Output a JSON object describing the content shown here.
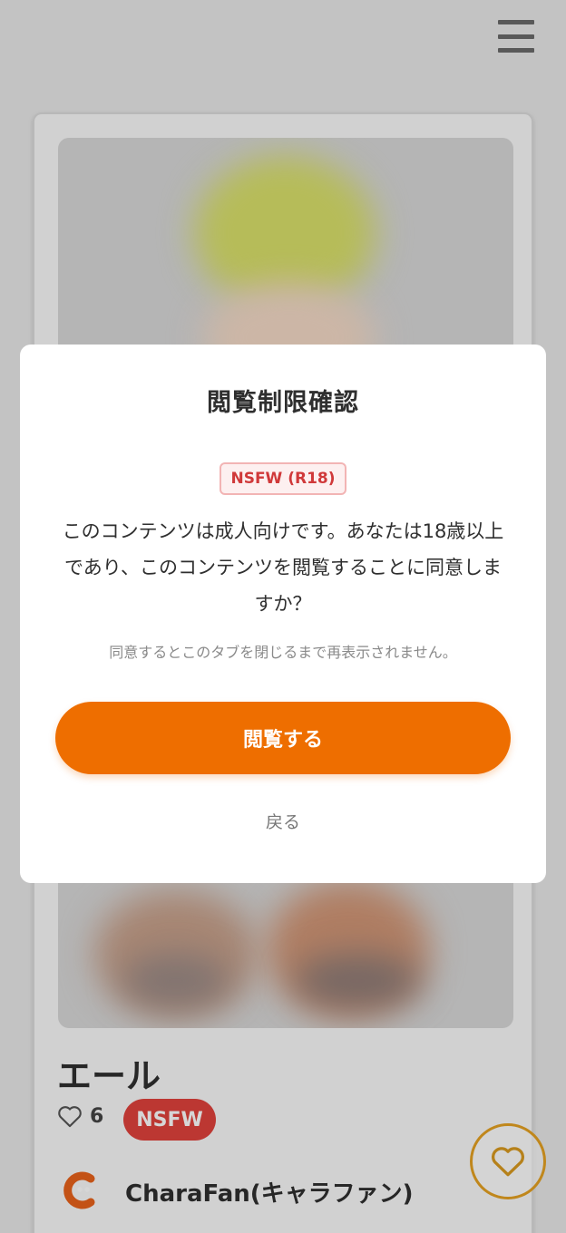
{
  "header": {
    "menu_icon": "hamburger-menu-icon"
  },
  "character": {
    "name": "エール",
    "like_count": "6",
    "rating_tag": "NSFW",
    "site_name": "CharaFan(キャラファン)",
    "favorite_icon": "heart-icon"
  },
  "modal": {
    "title": "閲覧制限確認",
    "rating_badge": "NSFW (R18)",
    "message": "このコンテンツは成人向けです。あなたは18歳以上であり、このコンテンツを閲覧することに同意しますか？",
    "note": "同意するとこのタブを閉じるまで再表示されません。",
    "confirm_label": "閲覧する",
    "back_label": "戻る"
  },
  "colors": {
    "accent_orange": "#ee6e00",
    "nsfw_red": "#e0423c",
    "favorite_gold": "#e5a122"
  }
}
